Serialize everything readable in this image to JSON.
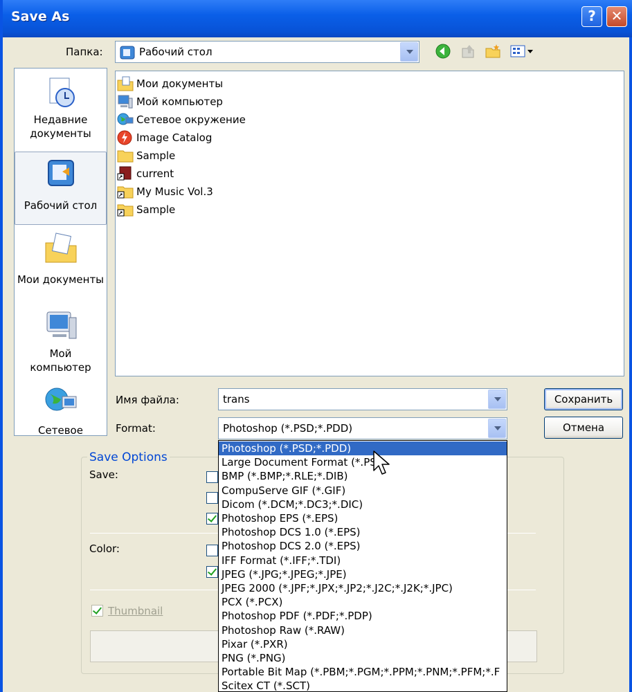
{
  "window": {
    "title": "Save As",
    "help_glyph": "?",
    "close_glyph": "✕"
  },
  "look_in": {
    "label": "Папка:",
    "value": "Рабочий стол"
  },
  "toolbar_icons": [
    "back-icon",
    "up-folder-icon",
    "new-folder-icon",
    "view-menu-icon"
  ],
  "places": [
    {
      "label": "Недавние документы",
      "icon": "recent-documents-icon"
    },
    {
      "label": "Рабочий стол",
      "icon": "desktop-icon"
    },
    {
      "label": "Мои документы",
      "icon": "my-documents-icon"
    },
    {
      "label": "Мой компьютер",
      "icon": "my-computer-icon"
    },
    {
      "label": "Сетевое",
      "icon": "network-icon"
    }
  ],
  "files": [
    {
      "name": "Мои документы",
      "icon": "my-documents-icon"
    },
    {
      "name": "Мой компьютер",
      "icon": "my-computer-icon"
    },
    {
      "name": "Сетевое окружение",
      "icon": "network-icon"
    },
    {
      "name": "Image Catalog",
      "icon": "flash-icon"
    },
    {
      "name": "Sample",
      "icon": "folder-icon"
    },
    {
      "name": "current",
      "icon": "shortcut-icon"
    },
    {
      "name": "My Music Vol.3",
      "icon": "folder-shortcut-icon"
    },
    {
      "name": "Sample",
      "icon": "folder-shortcut-icon"
    }
  ],
  "filename": {
    "label": "Имя файла:",
    "value": "trans"
  },
  "format": {
    "label": "Format:",
    "value": "Photoshop (*.PSD;*.PDD)"
  },
  "buttons": {
    "save": "Сохранить",
    "cancel": "Отмена"
  },
  "save_options": {
    "legend": "Save Options",
    "save_label": "Save:",
    "color_label": "Color:",
    "thumbnail_label": "Thumbnail",
    "thumbnail_checked": true
  },
  "format_options": [
    "Photoshop (*.PSD;*.PDD)",
    "Large Document Format (*.PS",
    "BMP (*.BMP;*.RLE;*.DIB)",
    "CompuServe GIF (*.GIF)",
    "Dicom (*.DCM;*.DC3;*.DIC)",
    "Photoshop EPS (*.EPS)",
    "Photoshop DCS 1.0 (*.EPS)",
    "Photoshop DCS 2.0 (*.EPS)",
    "IFF Format (*.IFF;*.TDI)",
    "JPEG (*.JPG;*.JPEG;*.JPE)",
    "JPEG 2000 (*.JPF;*.JPX;*.JP2;*.J2C;*.J2K;*.JPC)",
    "PCX (*.PCX)",
    "Photoshop PDF (*.PDF;*.PDP)",
    "Photoshop Raw (*.RAW)",
    "Pixar (*.PXR)",
    "PNG (*.PNG)",
    "Portable Bit Map (*.PBM;*.PGM;*.PPM;*.PNM;*.PFM;*.F",
    "Scitex CT (*.SCT)"
  ],
  "selected_format_index": 0,
  "colors": {
    "title_blue": "#0a5fe8",
    "selection": "#316ac5",
    "legend_blue": "#0046d5"
  }
}
